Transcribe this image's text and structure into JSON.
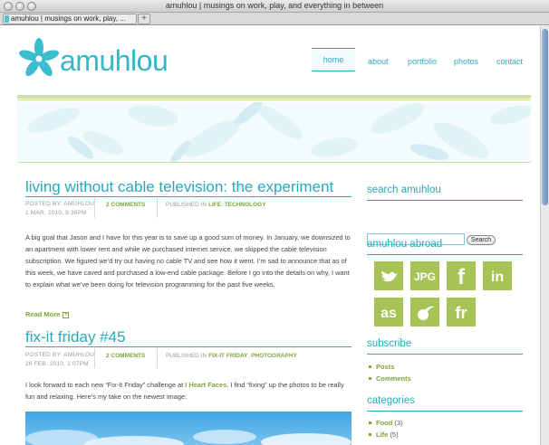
{
  "window": {
    "title": "amuhlou | musings on work, play, and everything in between"
  },
  "tab": {
    "label": "amuhlou | musings on work, play, ...",
    "new_tab": "+"
  },
  "site": {
    "logo_text": "amuhlou"
  },
  "nav": [
    "home",
    "about",
    "portfolio",
    "photos",
    "contact"
  ],
  "posts": [
    {
      "title": "living without cable television: the experiment",
      "author": "POSTED BY: AMUHLOU",
      "date": "1 MAR, 2010, 9:38PM",
      "comments": "2 COMMENTS",
      "published_prefix": "PUBLISHED IN",
      "categories": [
        "LIFE",
        "TECHNOLOGY"
      ],
      "excerpt": "A big goal that Jason and I have for this year is to save up a good sum of money. In January, we downsized to an apartment with lower rent and while we purchased internet service, we skipped the cable television subscription. We figured we’d try out having no cable TV and see how it went. I’m sad to announce that as of this week, we have caved and purchased a low-end cable package. Before I go into the details on why, I want to explain what we’ve been doing for television programming for the past five weeks.",
      "read_more": "Read More"
    },
    {
      "title": "fix-it friday #45",
      "author": "POSTED BY: AMUHLOU",
      "date": "26 FEB, 2010, 1:07PM",
      "comments": "2 COMMENTS",
      "published_prefix": "PUBLISHED IN",
      "categories": [
        "FIX-IT FRIDAY",
        "PHOTOGRAPHY"
      ],
      "excerpt_before": "I look forward to each new “Fix-It Friday” challenge at ",
      "excerpt_link": "I Heart Faces",
      "excerpt_after": ". I find “fixing” up the photos to be really fun and relaxing. Here’s my take on the newest image:"
    }
  ],
  "sidebar": {
    "search": {
      "heading": "search amuhlou",
      "button": "Search",
      "value": ""
    },
    "abroad": {
      "heading": "amuhlou abroad",
      "icons": [
        "twitter-icon",
        "jpg-icon",
        "facebook-icon",
        "linkedin-icon",
        "lastfm-icon",
        "ember-icon",
        "friendfeed-icon"
      ]
    },
    "subscribe": {
      "heading": "subscribe",
      "items": [
        "Posts",
        "Comments"
      ]
    },
    "categories": {
      "heading": "categories",
      "items": [
        {
          "name": "Food",
          "count": "(3)"
        },
        {
          "name": "Life",
          "count": "(5)"
        }
      ]
    }
  },
  "colors": {
    "accent": "#27a9bc",
    "green": "#a7c255",
    "link_green": "#7fa43a"
  }
}
